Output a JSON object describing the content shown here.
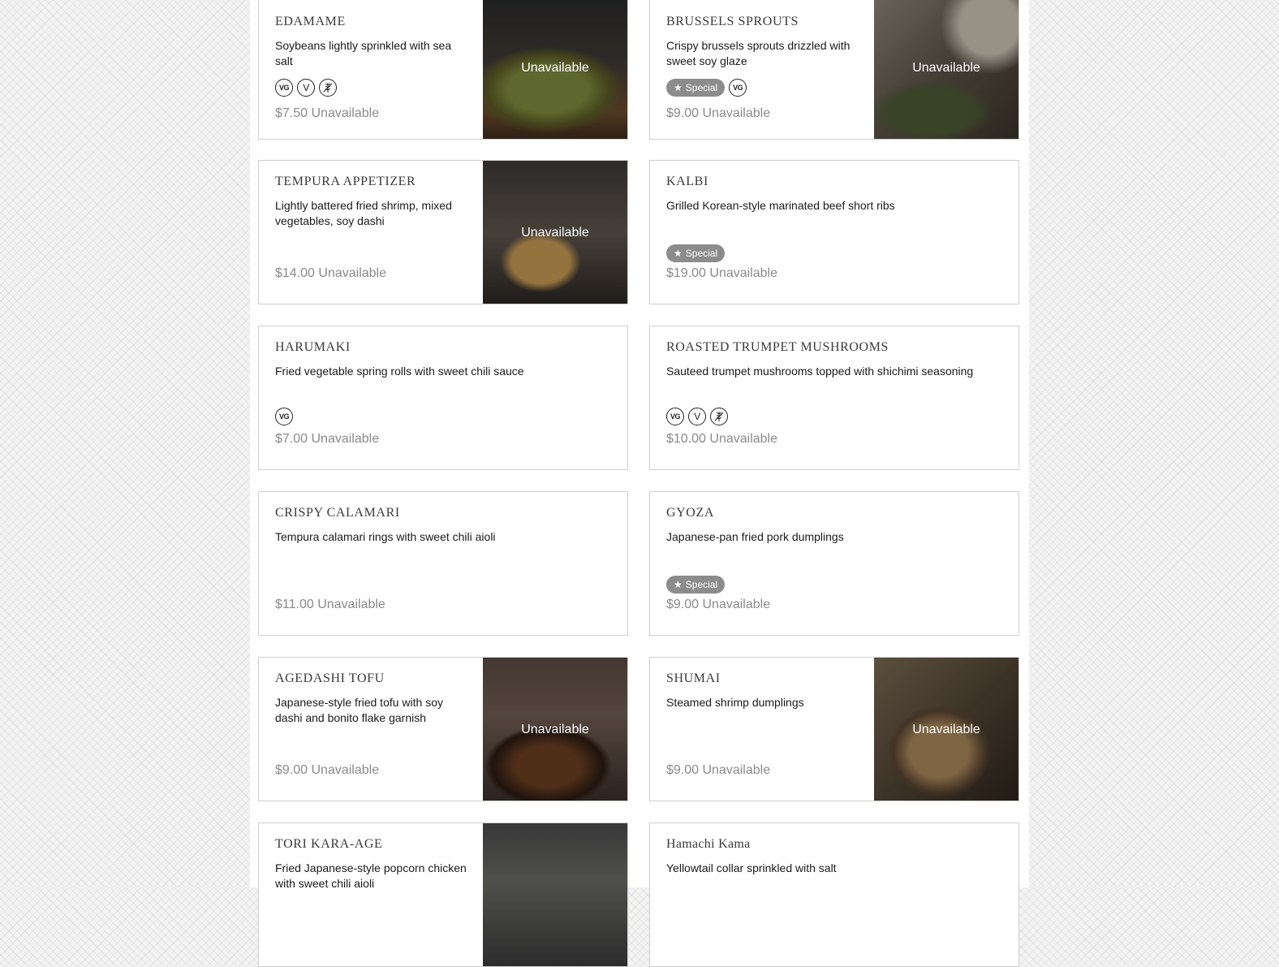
{
  "colors": {
    "badge": "#8c8c8c",
    "price": "#8a8a8a",
    "border": "#cfcfcf"
  },
  "items": [
    {
      "title": "EDAMAME",
      "desc": "Soybeans lightly sprinkled with sea salt",
      "special": false,
      "diet": [
        "VG",
        "V",
        "GF"
      ],
      "price": "$7.50 Unavailable",
      "photo_label": "Unavailable"
    },
    {
      "title": "BRUSSELS SPROUTS",
      "desc": "Crispy brussels sprouts drizzled with sweet soy glaze",
      "special": true,
      "diet": [
        "VG"
      ],
      "price": "$9.00 Unavailable",
      "photo_label": "Unavailable"
    },
    {
      "title": "TEMPURA APPETIZER",
      "desc": "Lightly battered fried shrimp, mixed vegetables, soy dashi",
      "special": false,
      "diet": [],
      "price": "$14.00 Unavailable",
      "photo_label": "Unavailable"
    },
    {
      "title": "KALBI",
      "desc": "Grilled Korean-style marinated beef short ribs",
      "special": true,
      "diet": [],
      "price": "$19.00 Unavailable"
    },
    {
      "title": "HARUMAKI",
      "desc": "Fried vegetable spring rolls with sweet chili sauce",
      "special": false,
      "diet": [
        "VG"
      ],
      "price": "$7.00 Unavailable"
    },
    {
      "title": "ROASTED TRUMPET MUSHROOMS",
      "desc": "Sauteed trumpet mushrooms topped with shichimi seasoning",
      "special": false,
      "diet": [
        "VG",
        "V",
        "GF"
      ],
      "price": "$10.00 Unavailable"
    },
    {
      "title": "CRISPY CALAMARI",
      "desc": "Tempura calamari rings with sweet chili aioli",
      "special": false,
      "diet": [],
      "price": "$11.00 Unavailable"
    },
    {
      "title": "GYOZA",
      "desc": "Japanese-pan fried pork dumplings",
      "special": true,
      "diet": [],
      "price": "$9.00 Unavailable"
    },
    {
      "title": "AGEDASHI TOFU",
      "desc": "Japanese-style fried tofu with soy dashi and bonito flake garnish",
      "special": false,
      "diet": [],
      "price": "$9.00 Unavailable",
      "photo_label": "Unavailable"
    },
    {
      "title": "SHUMAI",
      "desc": "Steamed shrimp dumplings",
      "special": false,
      "diet": [],
      "price": "$9.00 Unavailable",
      "photo_label": "Unavailable"
    },
    {
      "title": "TORI KARA-AGE",
      "desc": "Fried Japanese-style popcorn chicken with sweet chili aioli",
      "special": false,
      "diet": [],
      "price": ""
    },
    {
      "title": "Hamachi Kama",
      "desc": "Yellowtail collar sprinkled with salt",
      "special": false,
      "diet": [],
      "price": ""
    }
  ],
  "labels": {
    "special": "Special",
    "vg": "VG",
    "v": "V",
    "gf_icon": "gluten-free-icon",
    "star_icon": "star-icon"
  }
}
